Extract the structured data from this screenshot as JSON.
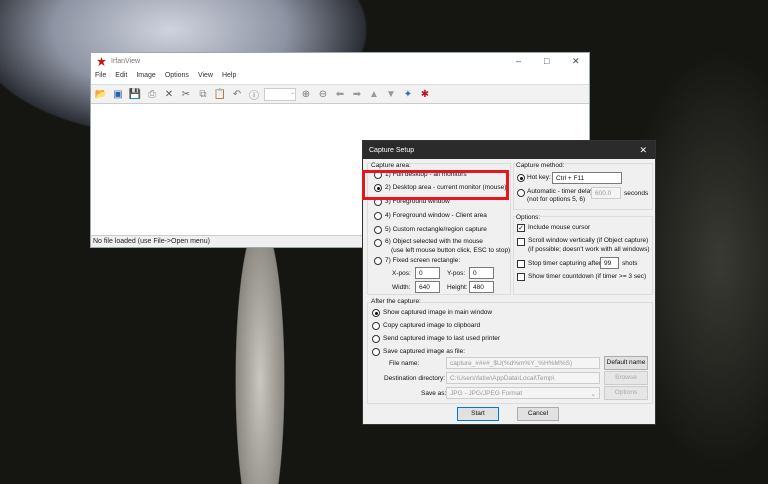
{
  "irfanview": {
    "title": "IrfanView",
    "menu": [
      "File",
      "Edit",
      "Image",
      "Options",
      "View",
      "Help"
    ],
    "status": "No file loaded (use File->Open menu)",
    "toolbar": [
      "folder-open-icon",
      "slideshow-icon",
      "save-icon",
      "print-icon",
      "delete-icon",
      "cut-icon",
      "copy-icon",
      "paste-icon",
      "undo-icon",
      "info-icon",
      "zoom-in-icon",
      "zoom-out-icon",
      "arrow-left-icon",
      "arrow-right-icon",
      "page-up-icon",
      "page-down-icon",
      "settings-icon",
      "irfanview-logo-icon"
    ]
  },
  "dialog": {
    "title": "Capture Setup",
    "capture_area": {
      "label": "Capture area:",
      "options": [
        "1) Full desktop - all monitors",
        "2) Desktop area - current monitor (mouse)",
        "3) Foreground window",
        "4) Foreground window - Client area",
        "5) Custom rectangle/region capture",
        "6) Object selected with the mouse",
        "7) Fixed screen rectangle:"
      ],
      "option6_sub": "(use left mouse button click, ESC to stop)",
      "selected": 1,
      "xpos_label": "X-pos:",
      "xpos": "0",
      "ypos_label": "Y-pos:",
      "ypos": "0",
      "width_label": "Width:",
      "width": "640",
      "height_label": "Height:",
      "height": "480"
    },
    "capture_method": {
      "label": "Capture method:",
      "hotkey_label": "Hot key:",
      "hotkey": "Ctrl + F11",
      "auto_label": "Automatic - timer delay:",
      "auto_sub": "(not for options 5, 6)",
      "delay": "600.0",
      "seconds": "seconds"
    },
    "options": {
      "label": "Options:",
      "include_cursor": "Include mouse cursor",
      "scroll": "Scroll window vertically (if Object capture)",
      "scroll_sub": "(if possible; doesn't work with all windows)",
      "stop_timer": "Stop timer capturing after:",
      "shots_value": "99",
      "shots": "shots",
      "countdown": "Show timer countdown (if timer >= 3 sec)"
    },
    "after": {
      "label": "After the capture:",
      "options": [
        "Show captured image in main window",
        "Copy captured image to clipboard",
        "Send captured image to last used printer",
        "Save captured image as file:"
      ],
      "file_name_label": "File name:",
      "file_name": "capture_####_$U(%d%m%Y_%H%M%S)",
      "default_name": "Default name",
      "dest_label": "Destination directory:",
      "dest": "C:\\Users\\fatiw\\AppData\\Local\\Temp\\",
      "browse": "Browse",
      "save_as_label": "Save as:",
      "save_as": "JPG - JPG/JPEG Format",
      "options_btn": "Options"
    },
    "start": "Start",
    "cancel": "Cancel"
  }
}
